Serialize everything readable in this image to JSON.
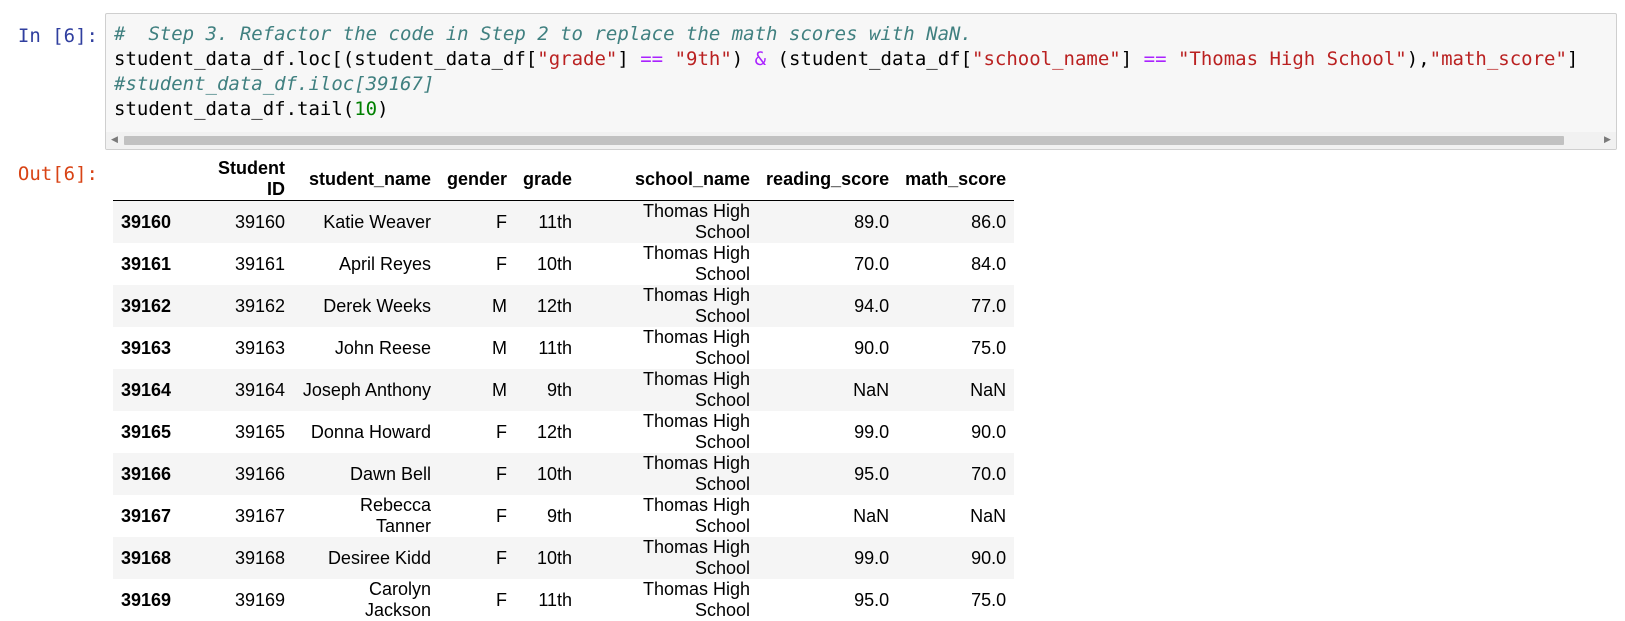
{
  "input_cell": {
    "prompt": "In [6]:",
    "code": {
      "line1": {
        "comment": "#  Step 3. Refactor the code in Step 2 to replace the math scores with NaN."
      },
      "line2": {
        "t1": "student_data_df.loc[(student_data_df[",
        "s1": "\"grade\"",
        "t2": "] ",
        "op1": "==",
        "t3": " ",
        "s2": "\"9th\"",
        "t4": ") ",
        "op2": "&",
        "t5": " (student_data_df[",
        "s3": "\"school_name\"",
        "t6": "] ",
        "op3": "==",
        "t7": " ",
        "s4": "\"Thomas High School\"",
        "t8": "),",
        "s5": "\"math_score\"",
        "t9": "]"
      },
      "line3": {
        "comment": "#student_data_df.iloc[39167]"
      },
      "line4": {
        "t1": "student_data_df.tail(",
        "num": "10",
        "t2": ")"
      }
    }
  },
  "output_cell": {
    "prompt": "Out[6]:",
    "table": {
      "columns": [
        "Student ID",
        "student_name",
        "gender",
        "grade",
        "school_name",
        "reading_score",
        "math_score"
      ],
      "rows": [
        {
          "index": "39160",
          "student_id": "39160",
          "student_name": "Katie Weaver",
          "gender": "F",
          "grade": "11th",
          "school_name": "Thomas High School",
          "reading_score": "89.0",
          "math_score": "86.0"
        },
        {
          "index": "39161",
          "student_id": "39161",
          "student_name": "April Reyes",
          "gender": "F",
          "grade": "10th",
          "school_name": "Thomas High School",
          "reading_score": "70.0",
          "math_score": "84.0"
        },
        {
          "index": "39162",
          "student_id": "39162",
          "student_name": "Derek Weeks",
          "gender": "M",
          "grade": "12th",
          "school_name": "Thomas High School",
          "reading_score": "94.0",
          "math_score": "77.0"
        },
        {
          "index": "39163",
          "student_id": "39163",
          "student_name": "John Reese",
          "gender": "M",
          "grade": "11th",
          "school_name": "Thomas High School",
          "reading_score": "90.0",
          "math_score": "75.0"
        },
        {
          "index": "39164",
          "student_id": "39164",
          "student_name": "Joseph Anthony",
          "gender": "M",
          "grade": "9th",
          "school_name": "Thomas High School",
          "reading_score": "NaN",
          "math_score": "NaN"
        },
        {
          "index": "39165",
          "student_id": "39165",
          "student_name": "Donna Howard",
          "gender": "F",
          "grade": "12th",
          "school_name": "Thomas High School",
          "reading_score": "99.0",
          "math_score": "90.0"
        },
        {
          "index": "39166",
          "student_id": "39166",
          "student_name": "Dawn Bell",
          "gender": "F",
          "grade": "10th",
          "school_name": "Thomas High School",
          "reading_score": "95.0",
          "math_score": "70.0"
        },
        {
          "index": "39167",
          "student_id": "39167",
          "student_name": "Rebecca Tanner",
          "gender": "F",
          "grade": "9th",
          "school_name": "Thomas High School",
          "reading_score": "NaN",
          "math_score": "NaN"
        },
        {
          "index": "39168",
          "student_id": "39168",
          "student_name": "Desiree Kidd",
          "gender": "F",
          "grade": "10th",
          "school_name": "Thomas High School",
          "reading_score": "99.0",
          "math_score": "90.0"
        },
        {
          "index": "39169",
          "student_id": "39169",
          "student_name": "Carolyn Jackson",
          "gender": "F",
          "grade": "11th",
          "school_name": "Thomas High School",
          "reading_score": "95.0",
          "math_score": "75.0"
        }
      ]
    }
  },
  "scrollbar": {
    "left_arrow_icon": "triangle-left",
    "right_arrow_icon": "triangle-right"
  }
}
